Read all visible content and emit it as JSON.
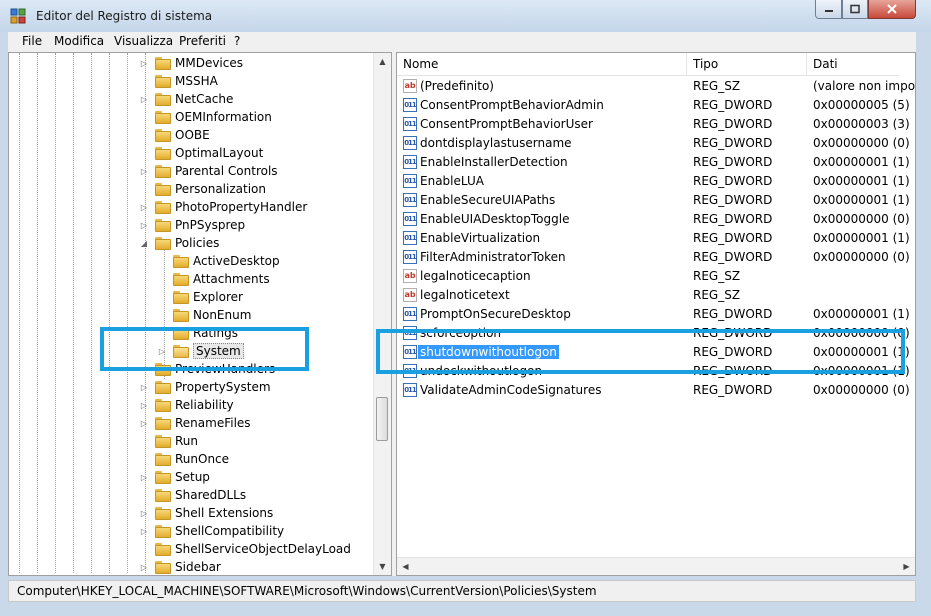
{
  "window": {
    "title": "Editor del Registro di sistema"
  },
  "menu": [
    "File",
    "Modifica",
    "Visualizza",
    "Preferiti",
    "?"
  ],
  "tree": [
    {
      "label": "MMDevices",
      "level": 0,
      "expander": "collapsed"
    },
    {
      "label": "MSSHA",
      "level": 0,
      "expander": "none"
    },
    {
      "label": "NetCache",
      "level": 0,
      "expander": "collapsed"
    },
    {
      "label": "OEMInformation",
      "level": 0,
      "expander": "none"
    },
    {
      "label": "OOBE",
      "level": 0,
      "expander": "none"
    },
    {
      "label": "OptimalLayout",
      "level": 0,
      "expander": "none"
    },
    {
      "label": "Parental Controls",
      "level": 0,
      "expander": "collapsed"
    },
    {
      "label": "Personalization",
      "level": 0,
      "expander": "none"
    },
    {
      "label": "PhotoPropertyHandler",
      "level": 0,
      "expander": "collapsed"
    },
    {
      "label": "PnPSysprep",
      "level": 0,
      "expander": "collapsed"
    },
    {
      "label": "Policies",
      "level": 0,
      "expander": "expanded"
    },
    {
      "label": "ActiveDesktop",
      "level": 1,
      "expander": "none"
    },
    {
      "label": "Attachments",
      "level": 1,
      "expander": "none"
    },
    {
      "label": "Explorer",
      "level": 1,
      "expander": "none"
    },
    {
      "label": "NonEnum",
      "level": 1,
      "expander": "none"
    },
    {
      "label": "Ratings",
      "level": 1,
      "expander": "none"
    },
    {
      "label": "System",
      "level": 1,
      "expander": "collapsed",
      "selected": true
    },
    {
      "label": "PreviewHandlers",
      "level": 0,
      "expander": "none"
    },
    {
      "label": "PropertySystem",
      "level": 0,
      "expander": "collapsed"
    },
    {
      "label": "Reliability",
      "level": 0,
      "expander": "collapsed"
    },
    {
      "label": "RenameFiles",
      "level": 0,
      "expander": "collapsed"
    },
    {
      "label": "Run",
      "level": 0,
      "expander": "none"
    },
    {
      "label": "RunOnce",
      "level": 0,
      "expander": "none"
    },
    {
      "label": "Setup",
      "level": 0,
      "expander": "collapsed"
    },
    {
      "label": "SharedDLLs",
      "level": 0,
      "expander": "none"
    },
    {
      "label": "Shell Extensions",
      "level": 0,
      "expander": "collapsed"
    },
    {
      "label": "ShellCompatibility",
      "level": 0,
      "expander": "collapsed"
    },
    {
      "label": "ShellServiceObjectDelayLoad",
      "level": 0,
      "expander": "none"
    },
    {
      "label": "Sidebar",
      "level": 0,
      "expander": "collapsed"
    }
  ],
  "list": {
    "columns": [
      "Nome",
      "Tipo",
      "Dati"
    ],
    "rows": [
      {
        "icon": "string-value-icon",
        "kind": "sz",
        "name": "(Predefinito)",
        "type": "REG_SZ",
        "data": "(valore non impostato)"
      },
      {
        "icon": "dword-value-icon",
        "kind": "dw",
        "name": "ConsentPromptBehaviorAdmin",
        "type": "REG_DWORD",
        "data": "0x00000005 (5)"
      },
      {
        "icon": "dword-value-icon",
        "kind": "dw",
        "name": "ConsentPromptBehaviorUser",
        "type": "REG_DWORD",
        "data": "0x00000003 (3)"
      },
      {
        "icon": "dword-value-icon",
        "kind": "dw",
        "name": "dontdisplaylastusername",
        "type": "REG_DWORD",
        "data": "0x00000000 (0)"
      },
      {
        "icon": "dword-value-icon",
        "kind": "dw",
        "name": "EnableInstallerDetection",
        "type": "REG_DWORD",
        "data": "0x00000001 (1)"
      },
      {
        "icon": "dword-value-icon",
        "kind": "dw",
        "name": "EnableLUA",
        "type": "REG_DWORD",
        "data": "0x00000001 (1)"
      },
      {
        "icon": "dword-value-icon",
        "kind": "dw",
        "name": "EnableSecureUIAPaths",
        "type": "REG_DWORD",
        "data": "0x00000001 (1)"
      },
      {
        "icon": "dword-value-icon",
        "kind": "dw",
        "name": "EnableUIADesktopToggle",
        "type": "REG_DWORD",
        "data": "0x00000000 (0)"
      },
      {
        "icon": "dword-value-icon",
        "kind": "dw",
        "name": "EnableVirtualization",
        "type": "REG_DWORD",
        "data": "0x00000001 (1)"
      },
      {
        "icon": "dword-value-icon",
        "kind": "dw",
        "name": "FilterAdministratorToken",
        "type": "REG_DWORD",
        "data": "0x00000000 (0)"
      },
      {
        "icon": "string-value-icon",
        "kind": "sz",
        "name": "legalnoticecaption",
        "type": "REG_SZ",
        "data": ""
      },
      {
        "icon": "string-value-icon",
        "kind": "sz",
        "name": "legalnoticetext",
        "type": "REG_SZ",
        "data": ""
      },
      {
        "icon": "dword-value-icon",
        "kind": "dw",
        "name": "PromptOnSecureDesktop",
        "type": "REG_DWORD",
        "data": "0x00000001 (1)"
      },
      {
        "icon": "dword-value-icon",
        "kind": "dw",
        "name": "scforceoption",
        "type": "REG_DWORD",
        "data": "0x00000000 (0)"
      },
      {
        "icon": "dword-value-icon",
        "kind": "dw",
        "name": "shutdownwithoutlogon",
        "type": "REG_DWORD",
        "data": "0x00000001 (1)",
        "selected": true
      },
      {
        "icon": "dword-value-icon",
        "kind": "dw",
        "name": "undockwithoutlogon",
        "type": "REG_DWORD",
        "data": "0x00000001 (1)"
      },
      {
        "icon": "dword-value-icon",
        "kind": "dw",
        "name": "ValidateAdminCodeSignatures",
        "type": "REG_DWORD",
        "data": "0x00000000 (0)"
      }
    ]
  },
  "status": {
    "path": "Computer\\HKEY_LOCAL_MACHINE\\SOFTWARE\\Microsoft\\Windows\\CurrentVersion\\Policies\\System"
  },
  "colors": {
    "highlight_box": "#1aa0e0",
    "selection": "#3399ff"
  }
}
